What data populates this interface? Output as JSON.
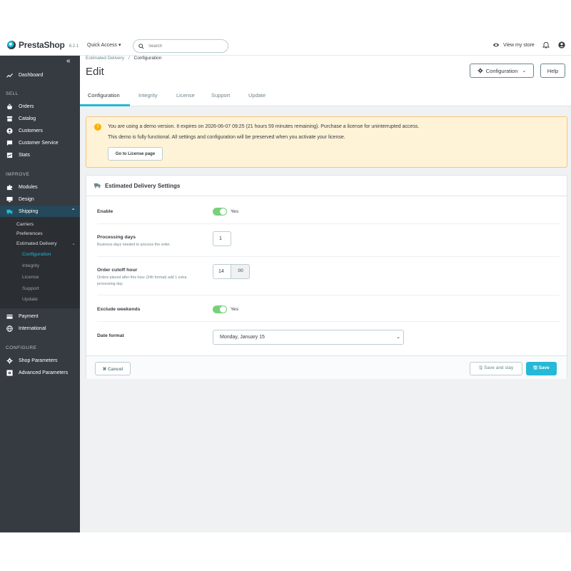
{
  "header": {
    "logo_text": "PrestaShop",
    "version": "8.2.1",
    "quick_access": "Quick Access ▾",
    "search_placeholder": "Search",
    "view_store": "View my store"
  },
  "sidebar": {
    "collapse": "«",
    "dashboard": "Dashboard",
    "sections": {
      "sell": "SELL",
      "improve": "IMPROVE",
      "configure": "CONFIGURE"
    },
    "sell_items": [
      "Orders",
      "Catalog",
      "Customers",
      "Customer Service",
      "Stats"
    ],
    "improve_items": [
      "Modules",
      "Design",
      "Shipping"
    ],
    "shipping_sub": [
      "Carriers",
      "Preferences",
      "Estimated Delivery"
    ],
    "estimated_sub": [
      "Configuration",
      "Integrity",
      "License",
      "Support",
      "Update"
    ],
    "after_items": [
      "Payment",
      "International"
    ],
    "configure_items": [
      "Shop Parameters",
      "Advanced Parameters"
    ]
  },
  "page": {
    "breadcrumb_parent": "Estimated Delivery",
    "breadcrumb_sep": "/",
    "breadcrumb_current": "Configuration",
    "title": "Edit",
    "config_button": "Configuration",
    "help_button": "Help"
  },
  "tabs": [
    "Configuration",
    "Integrity",
    "License",
    "Support",
    "Update"
  ],
  "alert": {
    "line1": "You are using a demo version. It expires on 2026-06-07 09:25 (21 hours 59 minutes remaining). Purchase a license for uninterrupted access.",
    "line2": "This demo is fully functional. All settings and configuration will be preserved when you activate your license.",
    "button": "Go to License page"
  },
  "form": {
    "title": "Estimated Delivery Settings",
    "enable_label": "Enable",
    "enable_value": "Yes",
    "processing_label": "Processing days",
    "processing_help": "Business days needed to process the order.",
    "processing_value": "1",
    "cutoff_label": "Order cutoff hour",
    "cutoff_help": "Orders placed after this hour (24h format) add 1 extra processing day.",
    "cutoff_value": "14",
    "cutoff_suffix": ":00",
    "weekends_label": "Exclude weekends",
    "weekends_value": "Yes",
    "date_label": "Date format",
    "date_value": "Monday, January 15"
  },
  "footer": {
    "cancel": "Cancel",
    "save_stay": "Save and stay",
    "save": "Save"
  },
  "colors": {
    "accent": "#25b9d7",
    "sidebar": "#363a41",
    "toggle_on": "#78d07d",
    "alert_bg": "#fff3d7"
  }
}
